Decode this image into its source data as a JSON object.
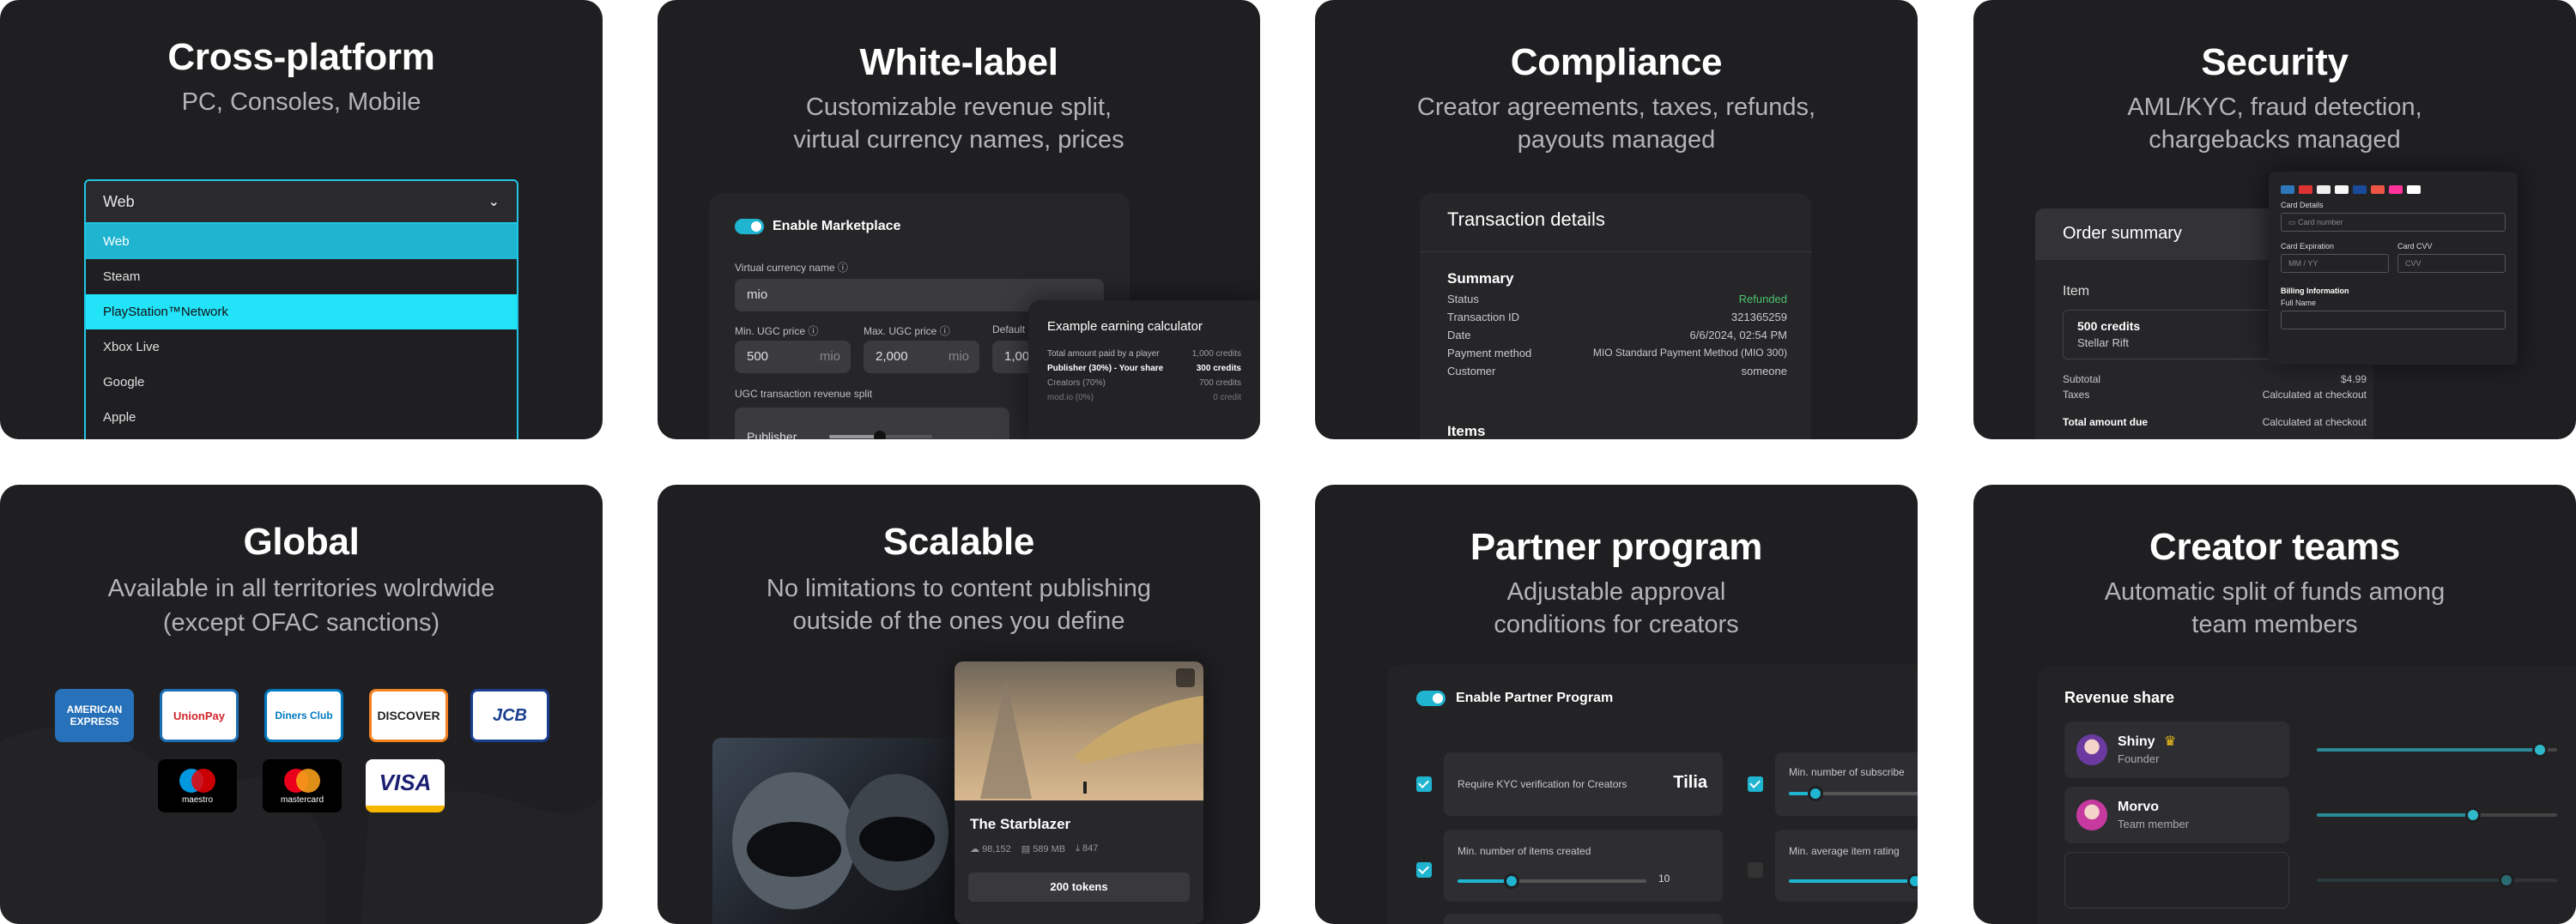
{
  "cross_platform": {
    "title": "Cross-platform",
    "subtitle": "PC, Consoles, Mobile",
    "dropdown_value": "Web",
    "options": [
      "Web",
      "Steam",
      "PlayStation™Network",
      "Xbox Live",
      "Google",
      "Apple"
    ],
    "accent": "#1fc6e4"
  },
  "white_label": {
    "title": "White-label",
    "subtitle_1": "Customizable revenue split,",
    "subtitle_2": "virtual currency names, prices",
    "toggle_label": "Enable Marketplace",
    "currency_name_label": "Virtual currency name",
    "currency_name_value": "mio",
    "min_price_label": "Min. UGC price",
    "min_price_value": "500",
    "min_price_unit": "mio",
    "max_price_label": "Max. UGC price",
    "max_price_value": "2,000",
    "max_price_unit": "mio",
    "default_label": "Default",
    "default_value": "1,00",
    "split_label": "UGC transaction revenue split",
    "publisher_label": "Publisher",
    "calc_title": "Example earning calculator",
    "calc_rows": [
      {
        "label": "Total amount paid by a player",
        "value": "1,000 credits"
      },
      {
        "label": "Publisher (30%) - Your share",
        "value": "300 credits"
      },
      {
        "label": "Creators (70%)",
        "value": "700 credits"
      },
      {
        "label": "mod.io (0%)",
        "value": "0 credit"
      }
    ]
  },
  "compliance": {
    "title": "Compliance",
    "subtitle_1": "Creator agreements, taxes, refunds,",
    "subtitle_2": "payouts managed",
    "panel_title": "Transaction details",
    "summary_label": "Summary",
    "rows": [
      {
        "label": "Status",
        "value": "Refunded"
      },
      {
        "label": "Transaction ID",
        "value": "321365259"
      },
      {
        "label": "Date",
        "value": "6/6/2024, 02:54 PM"
      },
      {
        "label": "Payment method",
        "value": "MIO Standard Payment Method (MIO 300)"
      },
      {
        "label": "Customer",
        "value": "someone"
      }
    ],
    "items_label": "Items",
    "status_color": "#4cc26a"
  },
  "security": {
    "title": "Security",
    "subtitle_1": "AML/KYC, fraud detection,",
    "subtitle_2": "chargebacks managed",
    "order_title": "Order summary",
    "item_label": "Item",
    "item_name": "500 credits",
    "item_sub": "Stellar Rift",
    "subtotal_label": "Subtotal",
    "subtotal_value": "$4.99",
    "taxes_label": "Taxes",
    "taxes_value": "Calculated at checkout",
    "total_label": "Total amount due",
    "total_value": "Calculated at checkout",
    "card_details_label": "Card Details",
    "card_number_placeholder": "Card number",
    "card_exp_label": "Card Expiration",
    "card_exp_placeholder": "MM / YY",
    "card_cvv_label": "Card CVV",
    "card_cvv_placeholder": "CVV",
    "billing_label": "Billing Information",
    "full_name_label": "Full Name"
  },
  "global": {
    "title": "Global",
    "subtitle_1": "Available in all territories wolrdwide",
    "subtitle_2": "(except OFAC sanctions)",
    "cards": [
      "AMERICAN EXPRESS",
      "UnionPay",
      "Diners Club",
      "DISCOVER",
      "JCB",
      "maestro",
      "mastercard",
      "VISA"
    ]
  },
  "scalable": {
    "title": "Scalable",
    "subtitle_1": "No limitations to content publishing",
    "subtitle_2": "outside of the ones you define",
    "mod_title": "The Starblazer",
    "stat_downloads": "98,152",
    "stat_size": "589 MB",
    "stat_subs": "847",
    "price_button": "200 tokens"
  },
  "partner": {
    "title": "Partner program",
    "subtitle_1": "Adjustable approval",
    "subtitle_2": "conditions for creators",
    "toggle_label": "Enable Partner Program",
    "kyc_label": "Require KYC verification for Creators",
    "kyc_brand": "Tilia",
    "min_items_label": "Min. number of items created",
    "min_items_value": "10",
    "min_subs_label": "Min. number of subscribe",
    "min_rating_label": "Min. average item rating"
  },
  "teams": {
    "title": "Creator teams",
    "subtitle_1": "Automatic split of funds among",
    "subtitle_2": "team members",
    "panel_title": "Revenue share",
    "members": [
      {
        "name": "Shiny",
        "role": "Founder",
        "share": 0.93
      },
      {
        "name": "Morvo",
        "role": "Team member",
        "share": 0.65
      }
    ],
    "empty_share": 0.79
  }
}
